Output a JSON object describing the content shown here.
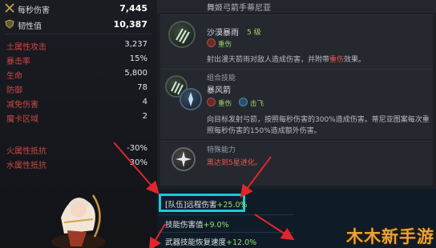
{
  "title": "舞姬弓箭手蒂尼亚",
  "stats_major": [
    {
      "label": "每秒伤害",
      "value": "7,445",
      "icon": "crossed-swords-icon"
    },
    {
      "label": "韧性值",
      "value": "10,387",
      "icon": "shield-icon"
    }
  ],
  "stats": [
    {
      "label": "土属性攻击",
      "value": "3,237"
    },
    {
      "label": "暴击率",
      "value": "15%"
    },
    {
      "label": "生命",
      "value": "5,800"
    },
    {
      "label": "防御",
      "value": "78"
    },
    {
      "label": "减免伤害",
      "value": "4"
    },
    {
      "label": "魔卡区域",
      "value": "2"
    },
    {
      "label": "火属性抵抗",
      "value": "-30%"
    },
    {
      "label": "水属性抵抗",
      "value": "30%"
    }
  ],
  "skills": [
    {
      "name": "沙漠暴雨",
      "level": "5 级",
      "tag": "重伤",
      "desc": "射出漫天箭雨对敌人造成伤害，并附带",
      "desc_highlight": "重伤",
      "desc_tail": "效果。"
    },
    {
      "category": "组合技能",
      "name": "暴风箭",
      "tag1": "重伤",
      "tag2": "击飞",
      "desc_line1": "向目标发射弓箭，按照每秒伤害的300%造成伤害。蒂尼亚图案每次重",
      "desc_line2": "照每秒伤害的150%造成额外伤害。"
    },
    {
      "category": "特殊能力",
      "desc": "黑达到5星进化。"
    }
  ],
  "bonuses": [
    {
      "label": "[队伍]远程伤害",
      "value": "+25.0%"
    },
    {
      "label": "技能伤害值",
      "value": "+9.0%"
    },
    {
      "label": "武器技能恢复速度",
      "value": "+12.0%"
    }
  ],
  "watermark": "木木新手游",
  "colors": {
    "stat_label": "#c94a42",
    "highlight_box": "#19c9d8",
    "positive_value": "#8fe26a",
    "arrow": "#e0262b",
    "watermark": "#e6a43a"
  }
}
